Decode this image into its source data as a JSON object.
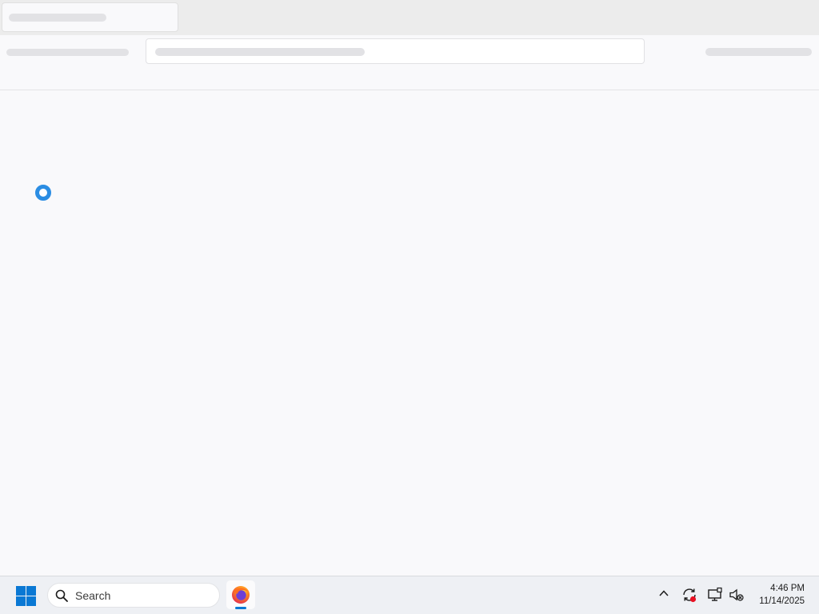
{
  "browser": {
    "state": "loading",
    "tab_title": "",
    "url": ""
  },
  "taskbar": {
    "start_icon": "windows-start-icon",
    "search": {
      "placeholder": "Search",
      "icon": "search-icon"
    },
    "pinned_apps": [
      {
        "name": "Firefox",
        "icon": "firefox-icon",
        "active": true
      }
    ],
    "tray": {
      "icons": [
        "chevron-up-icon",
        "sync-alert-icon",
        "network-icon",
        "volume-muted-icon"
      ],
      "time": "4:46 PM",
      "date": "11/14/2025"
    }
  },
  "colors": {
    "accent": "#0a78d4",
    "spinner": "#2b8de3",
    "alert": "#e81123"
  }
}
